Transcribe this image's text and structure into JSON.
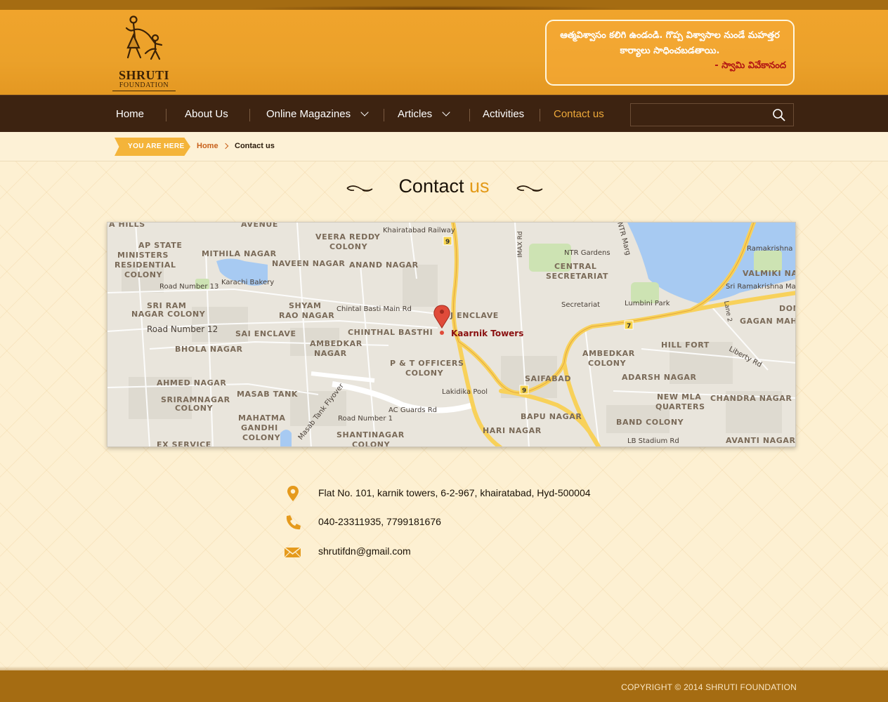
{
  "brand": {
    "name": "SHRUTI",
    "subtitle": "FOUNDATION"
  },
  "quote": {
    "text": "ఆత్మవిశ్వాసం కలిగి ఉండండి. గొప్ప విశ్వాసాల నుండే మహత్తర కార్యాలు సాధించబడతాయి.",
    "author": "- స్వామి వివేకానంద"
  },
  "nav": {
    "items": [
      {
        "label": "Home",
        "dropdown": false,
        "active": false
      },
      {
        "label": "About Us",
        "dropdown": false,
        "active": false
      },
      {
        "label": "Online Magazines",
        "dropdown": true,
        "active": false
      },
      {
        "label": "Articles",
        "dropdown": true,
        "active": false
      },
      {
        "label": "Activities",
        "dropdown": false,
        "active": false
      },
      {
        "label": "Contact us",
        "dropdown": false,
        "active": true
      }
    ],
    "search_value": "",
    "search_icon": "search-icon"
  },
  "breadcrumb": {
    "tag": "YOU ARE HERE",
    "home": "Home",
    "current": "Contact us"
  },
  "page": {
    "title_main": "Contact",
    "title_accent": "us"
  },
  "map": {
    "marker_label": "Kaarnik Towers",
    "labels": {
      "railway": "Khairatabad Railway",
      "veera": "VEERA REDDY",
      "colony": "COLONY",
      "ap_state": "AP STATE",
      "ministers": "MINISTERS",
      "residential": "RESIDENTIAL",
      "mithila": "MITHILA NAGAR",
      "naveen": "NAVEEN NAGAR",
      "anand": "ANAND NAGAR",
      "karachi": "Karachi Bakery",
      "road13": "Road Number 13",
      "sri_ram": "SRI RAM",
      "nagar_colony": "NAGAR COLONY",
      "shyam": "SHYAM",
      "rao_nagar": "RAO NAGAR",
      "chintal_road": "Chintal Basti Main Rd",
      "road12": "Road Number 12",
      "sai_enclave": "SAI ENCLAVE",
      "chinthal": "CHINTHAL BASTHI",
      "bhola": "BHOLA NAGAR",
      "ambedkar": "AMBEDKAR",
      "nagar": "NAGAR",
      "pt_officers": "P & T OFFICERS",
      "ahmed": "AHMED NAGAR",
      "masab": "MASAB TANK",
      "sriramnagar": "SRIRAMNAGAR",
      "lakidika": "Lakidika Pool",
      "flyover": "Masab Tank Flyover",
      "ac_guards": "AC Guards Rd",
      "road1": "Road Number 1",
      "mahatma": "MAHATMA",
      "gandhi": "GANDHI",
      "shantinagar": "SHANTINAGAR",
      "ex_service": "EX SERVICE",
      "hari": "HARI NAGAR",
      "bapu": "BAPU NAGAR",
      "saifabad": "SAIFABAD",
      "imax": "IMAX Rd",
      "ntr_marg": "NTR Marg",
      "ntr_gardens": "NTR Gardens",
      "central": "CENTRAL",
      "secretariat_area": "SECRETARIAT",
      "secretariat": "Secretariat",
      "lumbini": "Lumbini Park",
      "enclave": "J ENCLAVE",
      "ramakrishna": "Ramakrishna",
      "valmiki": "VALMIKI NAGAR",
      "sri_ramakrishna": "Sri Ramakrishna Ma",
      "dom": "DOM",
      "gagan": "GAGAN MAHA",
      "lane2": "Lane 2",
      "liberty": "Liberty Rd",
      "hill_fort": "HILL FORT",
      "ambedkar_colony": "AMBEDKAR",
      "adarsh": "ADARSH NAGAR",
      "new_mla": "NEW MLA",
      "quarters": "QUARTERS",
      "chandra": "CHANDRA NAGAR",
      "band": "BAND COLONY",
      "avanti": "AVANTI NAGAR",
      "lb_stadium": "LB Stadium Rd",
      "a_hills": "A HILLS",
      "avenue": "AVENUE"
    },
    "badges": {
      "r9a": "9",
      "r9b": "9",
      "r7": "7"
    }
  },
  "contact": {
    "address": "Flat No. 101, karnik towers, 6-2-967, khairatabad, Hyd-500004",
    "phone": "040-23311935, 7799181676",
    "email": "shrutifdn@gmail.com",
    "icons": [
      "location-pin-icon",
      "phone-icon",
      "envelope-icon"
    ]
  },
  "footer": {
    "copyright": "COPYRIGHT © 2014 SHRUTI FOUNDATION"
  },
  "colors": {
    "header": "#eba12a",
    "nav": "#3d2311",
    "accent": "#e39a18",
    "footer": "#a56c12",
    "active_nav": "#eea93a"
  }
}
